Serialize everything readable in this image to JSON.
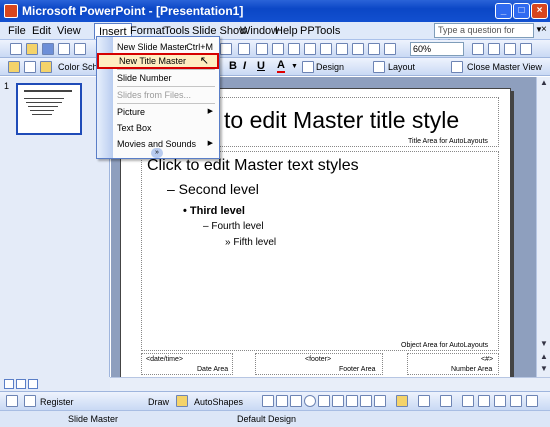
{
  "window": {
    "title": "Microsoft PowerPoint - [Presentation1]"
  },
  "menubar": {
    "items": [
      "File",
      "Edit",
      "View",
      "Insert",
      "Format",
      "Tools",
      "Slide Show",
      "Window",
      "Help",
      "PPTools"
    ],
    "help_placeholder": "Type a question for help"
  },
  "toolbar1": {
    "zoom": "60%"
  },
  "toolbar2": {
    "color_scheme": "Color Sche",
    "bold": "B",
    "italic": "I",
    "underline": "U",
    "font_color": "A",
    "design": "Design",
    "layout": "Layout",
    "close_master": "Close Master View"
  },
  "insert_menu": {
    "items": [
      {
        "label": "New Slide Master",
        "shortcut": "Ctrl+M"
      },
      {
        "label": "New Title Master"
      },
      {
        "label": "Slide Number"
      },
      {
        "label": "Slides from Files..."
      },
      {
        "label": "Picture"
      },
      {
        "label": "Text Box"
      },
      {
        "label": "Movies and Sounds"
      }
    ]
  },
  "slide_panel": {
    "slide_number": "1"
  },
  "slide": {
    "title": "to edit Master title style",
    "title_area_label": "Title Area for AutoLayouts",
    "bullets": [
      "Click to edit Master text styles",
      "– Second level",
      "• Third level",
      "– Fourth level",
      "» Fifth level"
    ],
    "object_area_label": "Object Area for AutoLayouts",
    "date_placeholder": "<date/time>",
    "date_label": "Date Area",
    "footer_placeholder": "<footer>",
    "footer_label": "Footer Area",
    "number_placeholder": "<#>",
    "number_label": "Number Area"
  },
  "drawing_toolbar": {
    "register": "Register",
    "draw": "Draw",
    "autoshapes": "AutoShapes"
  },
  "status": {
    "view": "Slide Master",
    "design": "Default Design"
  }
}
